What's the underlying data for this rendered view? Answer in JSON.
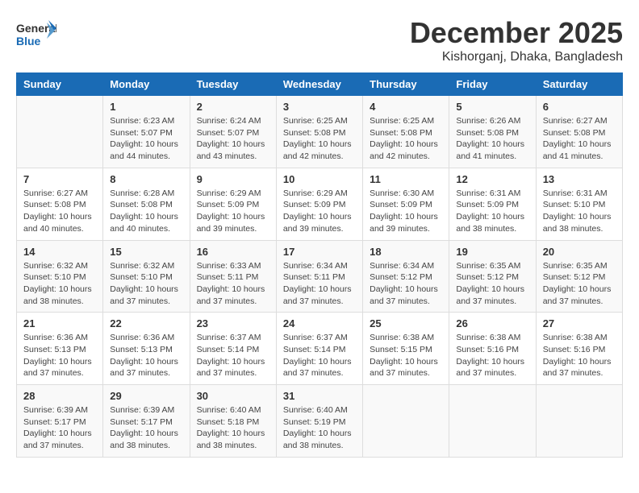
{
  "header": {
    "logo_general": "General",
    "logo_blue": "Blue",
    "month_title": "December 2025",
    "location": "Kishorganj, Dhaka, Bangladesh"
  },
  "weekdays": [
    "Sunday",
    "Monday",
    "Tuesday",
    "Wednesday",
    "Thursday",
    "Friday",
    "Saturday"
  ],
  "weeks": [
    [
      {
        "day": "",
        "sunrise": "",
        "sunset": "",
        "daylight": ""
      },
      {
        "day": "1",
        "sunrise": "6:23 AM",
        "sunset": "5:07 PM",
        "daylight": "10 hours and 44 minutes."
      },
      {
        "day": "2",
        "sunrise": "6:24 AM",
        "sunset": "5:07 PM",
        "daylight": "10 hours and 43 minutes."
      },
      {
        "day": "3",
        "sunrise": "6:25 AM",
        "sunset": "5:08 PM",
        "daylight": "10 hours and 42 minutes."
      },
      {
        "day": "4",
        "sunrise": "6:25 AM",
        "sunset": "5:08 PM",
        "daylight": "10 hours and 42 minutes."
      },
      {
        "day": "5",
        "sunrise": "6:26 AM",
        "sunset": "5:08 PM",
        "daylight": "10 hours and 41 minutes."
      },
      {
        "day": "6",
        "sunrise": "6:27 AM",
        "sunset": "5:08 PM",
        "daylight": "10 hours and 41 minutes."
      }
    ],
    [
      {
        "day": "7",
        "sunrise": "6:27 AM",
        "sunset": "5:08 PM",
        "daylight": "10 hours and 40 minutes."
      },
      {
        "day": "8",
        "sunrise": "6:28 AM",
        "sunset": "5:08 PM",
        "daylight": "10 hours and 40 minutes."
      },
      {
        "day": "9",
        "sunrise": "6:29 AM",
        "sunset": "5:09 PM",
        "daylight": "10 hours and 39 minutes."
      },
      {
        "day": "10",
        "sunrise": "6:29 AM",
        "sunset": "5:09 PM",
        "daylight": "10 hours and 39 minutes."
      },
      {
        "day": "11",
        "sunrise": "6:30 AM",
        "sunset": "5:09 PM",
        "daylight": "10 hours and 39 minutes."
      },
      {
        "day": "12",
        "sunrise": "6:31 AM",
        "sunset": "5:09 PM",
        "daylight": "10 hours and 38 minutes."
      },
      {
        "day": "13",
        "sunrise": "6:31 AM",
        "sunset": "5:10 PM",
        "daylight": "10 hours and 38 minutes."
      }
    ],
    [
      {
        "day": "14",
        "sunrise": "6:32 AM",
        "sunset": "5:10 PM",
        "daylight": "10 hours and 38 minutes."
      },
      {
        "day": "15",
        "sunrise": "6:32 AM",
        "sunset": "5:10 PM",
        "daylight": "10 hours and 37 minutes."
      },
      {
        "day": "16",
        "sunrise": "6:33 AM",
        "sunset": "5:11 PM",
        "daylight": "10 hours and 37 minutes."
      },
      {
        "day": "17",
        "sunrise": "6:34 AM",
        "sunset": "5:11 PM",
        "daylight": "10 hours and 37 minutes."
      },
      {
        "day": "18",
        "sunrise": "6:34 AM",
        "sunset": "5:12 PM",
        "daylight": "10 hours and 37 minutes."
      },
      {
        "day": "19",
        "sunrise": "6:35 AM",
        "sunset": "5:12 PM",
        "daylight": "10 hours and 37 minutes."
      },
      {
        "day": "20",
        "sunrise": "6:35 AM",
        "sunset": "5:12 PM",
        "daylight": "10 hours and 37 minutes."
      }
    ],
    [
      {
        "day": "21",
        "sunrise": "6:36 AM",
        "sunset": "5:13 PM",
        "daylight": "10 hours and 37 minutes."
      },
      {
        "day": "22",
        "sunrise": "6:36 AM",
        "sunset": "5:13 PM",
        "daylight": "10 hours and 37 minutes."
      },
      {
        "day": "23",
        "sunrise": "6:37 AM",
        "sunset": "5:14 PM",
        "daylight": "10 hours and 37 minutes."
      },
      {
        "day": "24",
        "sunrise": "6:37 AM",
        "sunset": "5:14 PM",
        "daylight": "10 hours and 37 minutes."
      },
      {
        "day": "25",
        "sunrise": "6:38 AM",
        "sunset": "5:15 PM",
        "daylight": "10 hours and 37 minutes."
      },
      {
        "day": "26",
        "sunrise": "6:38 AM",
        "sunset": "5:16 PM",
        "daylight": "10 hours and 37 minutes."
      },
      {
        "day": "27",
        "sunrise": "6:38 AM",
        "sunset": "5:16 PM",
        "daylight": "10 hours and 37 minutes."
      }
    ],
    [
      {
        "day": "28",
        "sunrise": "6:39 AM",
        "sunset": "5:17 PM",
        "daylight": "10 hours and 37 minutes."
      },
      {
        "day": "29",
        "sunrise": "6:39 AM",
        "sunset": "5:17 PM",
        "daylight": "10 hours and 38 minutes."
      },
      {
        "day": "30",
        "sunrise": "6:40 AM",
        "sunset": "5:18 PM",
        "daylight": "10 hours and 38 minutes."
      },
      {
        "day": "31",
        "sunrise": "6:40 AM",
        "sunset": "5:19 PM",
        "daylight": "10 hours and 38 minutes."
      },
      {
        "day": "",
        "sunrise": "",
        "sunset": "",
        "daylight": ""
      },
      {
        "day": "",
        "sunrise": "",
        "sunset": "",
        "daylight": ""
      },
      {
        "day": "",
        "sunrise": "",
        "sunset": "",
        "daylight": ""
      }
    ]
  ]
}
